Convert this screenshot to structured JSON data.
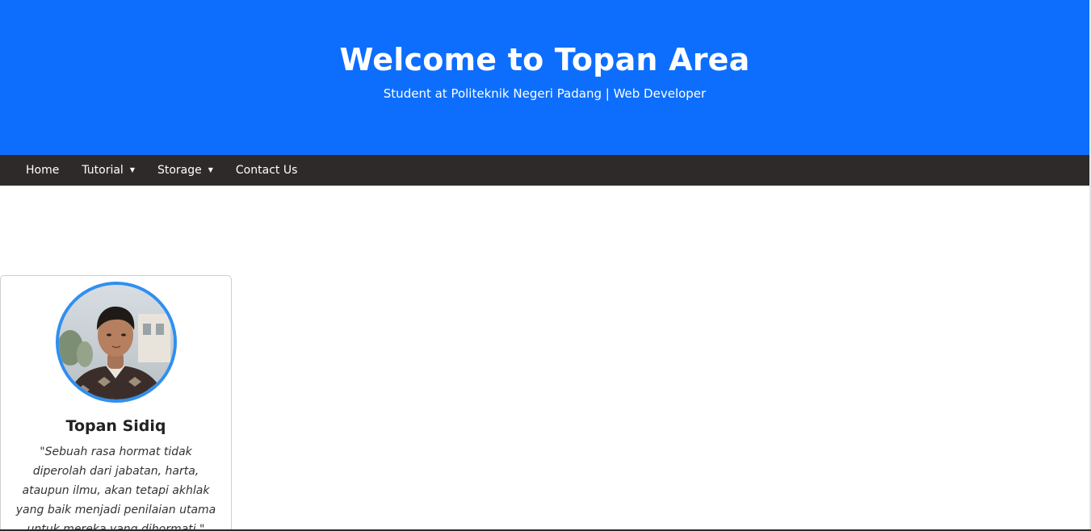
{
  "header": {
    "title": "Welcome to Topan Area",
    "subtitle": "Student at Politeknik Negeri Padang | Web Developer"
  },
  "nav": {
    "items": [
      {
        "label": "Home",
        "has_dropdown": false
      },
      {
        "label": "Tutorial",
        "has_dropdown": true
      },
      {
        "label": "Storage",
        "has_dropdown": true
      },
      {
        "label": "Contact Us",
        "has_dropdown": false
      }
    ],
    "dropdown_glyph": "▼"
  },
  "profile": {
    "name": "Topan Sidiq",
    "quote": "\"Sebuah rasa hormat tidak diperolah dari jabatan, harta, ataupun ilmu, akan tetapi akhlak yang baik menjadi penilaian utama untuk mereka yang dihormati.\"",
    "avatar_icon": "profile-photo"
  },
  "colors": {
    "hero_bg": "#0d6efd",
    "nav_bg": "#2f2a2a",
    "avatar_border": "#2f8ff0"
  }
}
